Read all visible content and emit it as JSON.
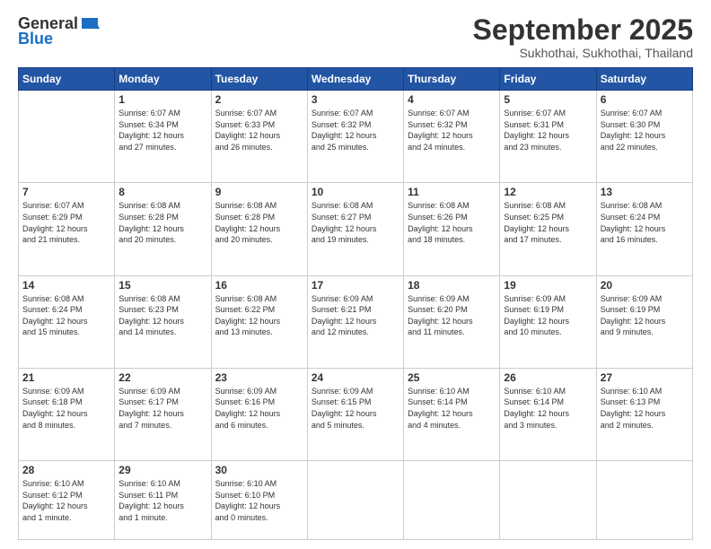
{
  "logo": {
    "general": "General",
    "blue": "Blue"
  },
  "header": {
    "month": "September 2025",
    "location": "Sukhothai, Sukhothai, Thailand"
  },
  "weekdays": [
    "Sunday",
    "Monday",
    "Tuesday",
    "Wednesday",
    "Thursday",
    "Friday",
    "Saturday"
  ],
  "weeks": [
    [
      {
        "day": "",
        "info": ""
      },
      {
        "day": "1",
        "info": "Sunrise: 6:07 AM\nSunset: 6:34 PM\nDaylight: 12 hours\nand 27 minutes."
      },
      {
        "day": "2",
        "info": "Sunrise: 6:07 AM\nSunset: 6:33 PM\nDaylight: 12 hours\nand 26 minutes."
      },
      {
        "day": "3",
        "info": "Sunrise: 6:07 AM\nSunset: 6:32 PM\nDaylight: 12 hours\nand 25 minutes."
      },
      {
        "day": "4",
        "info": "Sunrise: 6:07 AM\nSunset: 6:32 PM\nDaylight: 12 hours\nand 24 minutes."
      },
      {
        "day": "5",
        "info": "Sunrise: 6:07 AM\nSunset: 6:31 PM\nDaylight: 12 hours\nand 23 minutes."
      },
      {
        "day": "6",
        "info": "Sunrise: 6:07 AM\nSunset: 6:30 PM\nDaylight: 12 hours\nand 22 minutes."
      }
    ],
    [
      {
        "day": "7",
        "info": "Sunrise: 6:07 AM\nSunset: 6:29 PM\nDaylight: 12 hours\nand 21 minutes."
      },
      {
        "day": "8",
        "info": "Sunrise: 6:08 AM\nSunset: 6:28 PM\nDaylight: 12 hours\nand 20 minutes."
      },
      {
        "day": "9",
        "info": "Sunrise: 6:08 AM\nSunset: 6:28 PM\nDaylight: 12 hours\nand 20 minutes."
      },
      {
        "day": "10",
        "info": "Sunrise: 6:08 AM\nSunset: 6:27 PM\nDaylight: 12 hours\nand 19 minutes."
      },
      {
        "day": "11",
        "info": "Sunrise: 6:08 AM\nSunset: 6:26 PM\nDaylight: 12 hours\nand 18 minutes."
      },
      {
        "day": "12",
        "info": "Sunrise: 6:08 AM\nSunset: 6:25 PM\nDaylight: 12 hours\nand 17 minutes."
      },
      {
        "day": "13",
        "info": "Sunrise: 6:08 AM\nSunset: 6:24 PM\nDaylight: 12 hours\nand 16 minutes."
      }
    ],
    [
      {
        "day": "14",
        "info": "Sunrise: 6:08 AM\nSunset: 6:24 PM\nDaylight: 12 hours\nand 15 minutes."
      },
      {
        "day": "15",
        "info": "Sunrise: 6:08 AM\nSunset: 6:23 PM\nDaylight: 12 hours\nand 14 minutes."
      },
      {
        "day": "16",
        "info": "Sunrise: 6:08 AM\nSunset: 6:22 PM\nDaylight: 12 hours\nand 13 minutes."
      },
      {
        "day": "17",
        "info": "Sunrise: 6:09 AM\nSunset: 6:21 PM\nDaylight: 12 hours\nand 12 minutes."
      },
      {
        "day": "18",
        "info": "Sunrise: 6:09 AM\nSunset: 6:20 PM\nDaylight: 12 hours\nand 11 minutes."
      },
      {
        "day": "19",
        "info": "Sunrise: 6:09 AM\nSunset: 6:19 PM\nDaylight: 12 hours\nand 10 minutes."
      },
      {
        "day": "20",
        "info": "Sunrise: 6:09 AM\nSunset: 6:19 PM\nDaylight: 12 hours\nand 9 minutes."
      }
    ],
    [
      {
        "day": "21",
        "info": "Sunrise: 6:09 AM\nSunset: 6:18 PM\nDaylight: 12 hours\nand 8 minutes."
      },
      {
        "day": "22",
        "info": "Sunrise: 6:09 AM\nSunset: 6:17 PM\nDaylight: 12 hours\nand 7 minutes."
      },
      {
        "day": "23",
        "info": "Sunrise: 6:09 AM\nSunset: 6:16 PM\nDaylight: 12 hours\nand 6 minutes."
      },
      {
        "day": "24",
        "info": "Sunrise: 6:09 AM\nSunset: 6:15 PM\nDaylight: 12 hours\nand 5 minutes."
      },
      {
        "day": "25",
        "info": "Sunrise: 6:10 AM\nSunset: 6:14 PM\nDaylight: 12 hours\nand 4 minutes."
      },
      {
        "day": "26",
        "info": "Sunrise: 6:10 AM\nSunset: 6:14 PM\nDaylight: 12 hours\nand 3 minutes."
      },
      {
        "day": "27",
        "info": "Sunrise: 6:10 AM\nSunset: 6:13 PM\nDaylight: 12 hours\nand 2 minutes."
      }
    ],
    [
      {
        "day": "28",
        "info": "Sunrise: 6:10 AM\nSunset: 6:12 PM\nDaylight: 12 hours\nand 1 minute."
      },
      {
        "day": "29",
        "info": "Sunrise: 6:10 AM\nSunset: 6:11 PM\nDaylight: 12 hours\nand 1 minute."
      },
      {
        "day": "30",
        "info": "Sunrise: 6:10 AM\nSunset: 6:10 PM\nDaylight: 12 hours\nand 0 minutes."
      },
      {
        "day": "",
        "info": ""
      },
      {
        "day": "",
        "info": ""
      },
      {
        "day": "",
        "info": ""
      },
      {
        "day": "",
        "info": ""
      }
    ]
  ]
}
